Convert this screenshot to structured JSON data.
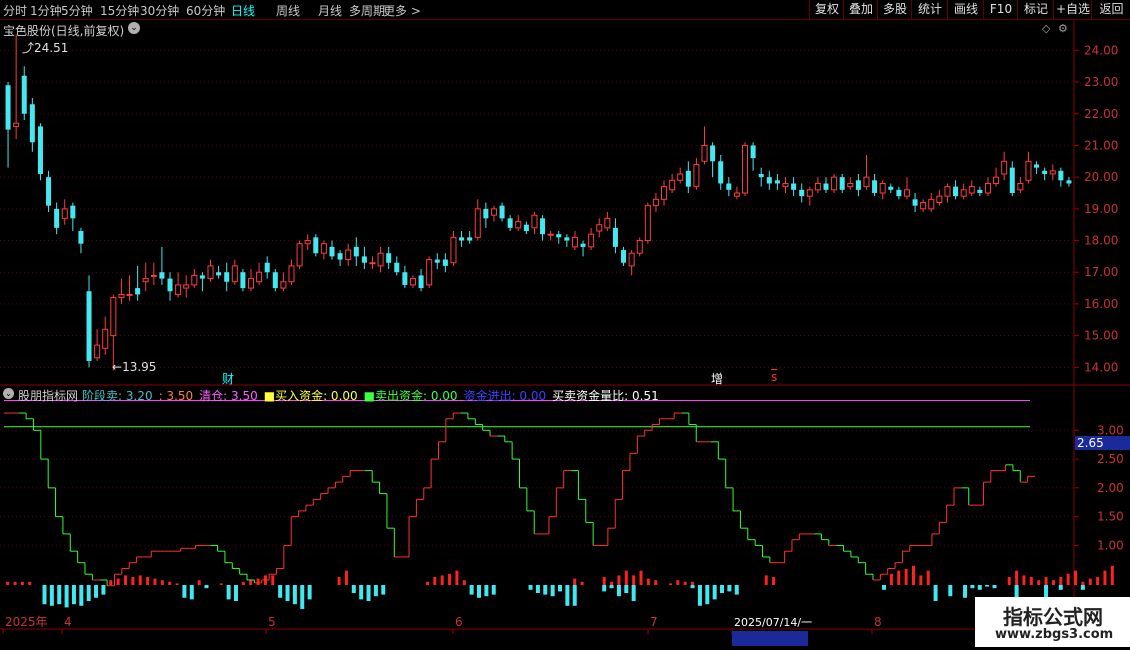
{
  "toolbar": {
    "periods": [
      "分时",
      "1分钟",
      "5分钟",
      "15分钟",
      "30分钟",
      "60分钟",
      "日线",
      "周线",
      "月线",
      "多周期",
      "更多 >"
    ],
    "active_period": "日线",
    "right_buttons": [
      "复权",
      "叠加",
      "多股",
      "统计",
      "画线",
      "F10",
      "标记",
      "+自选",
      "返回"
    ]
  },
  "main_chart": {
    "title": "宝色股份(日线,前复权)",
    "high_label": "24.51",
    "low_label": "13.95",
    "event_markers": [
      {
        "text": "财",
        "color": "#00ffff"
      },
      {
        "text": "增",
        "color": "#ffffff"
      },
      {
        "text": "s",
        "color": "#ff3030"
      }
    ],
    "y_ticks": [
      "24.00",
      "23.00",
      "22.00",
      "21.00",
      "20.00",
      "19.00",
      "18.00",
      "17.00",
      "16.00",
      "15.00",
      "14.00"
    ]
  },
  "indicator_panel": {
    "name": "股朋指标网",
    "items": [
      {
        "label": "阶段卖:",
        "value": "3.20",
        "color": "#40c0c0"
      },
      {
        "label": ":",
        "value": "3.50",
        "color": "#ff8040"
      },
      {
        "label": "清仓:",
        "value": "3.50",
        "color": "#ff60ff"
      },
      {
        "label": "■买入资金:",
        "value": "0.00",
        "color": "#ffff40"
      },
      {
        "label": "■卖出资金:",
        "value": "0.00",
        "color": "#40ff40"
      },
      {
        "label": "资金进出:",
        "value": "0.00",
        "color": "#4040ff"
      },
      {
        "label": "买卖资金量比:",
        "value": "0.51",
        "color": "#ffffff"
      }
    ],
    "y_ticks": [
      "3.00",
      "2.50",
      "2.00",
      "1.50",
      "1.00"
    ],
    "current_value": "2.65"
  },
  "time_axis": {
    "labels": [
      "2025年",
      "4",
      "5",
      "6",
      "7",
      "2025/07/14/一",
      "8"
    ]
  },
  "watermark": {
    "title": "指标公式网",
    "url": "www.zbgs3.com"
  },
  "chart_data": [
    {
      "type": "candlestick",
      "title": "宝色股份(日线,前复权)",
      "ylim": [
        13.6,
        24.8
      ],
      "high": 24.51,
      "low": 13.95,
      "candles": [
        [
          22.9,
          21.5,
          23.0,
          20.3
        ],
        [
          21.6,
          21.7,
          24.5,
          21.2
        ],
        [
          23.2,
          22.0,
          23.5,
          21.8
        ],
        [
          22.3,
          21.1,
          22.5,
          20.8
        ],
        [
          21.6,
          20.1,
          21.7,
          19.9
        ],
        [
          20.0,
          19.1,
          20.2,
          18.9
        ],
        [
          19.0,
          18.4,
          19.2,
          18.2
        ],
        [
          18.7,
          19.0,
          19.3,
          18.5
        ],
        [
          19.1,
          18.7,
          19.2,
          18.3
        ],
        [
          18.3,
          17.9,
          18.4,
          17.6
        ],
        [
          16.4,
          14.2,
          16.9,
          14.0
        ],
        [
          14.3,
          14.7,
          15.2,
          14.2
        ],
        [
          14.6,
          15.2,
          15.6,
          14.4
        ],
        [
          15.0,
          16.2,
          16.3,
          13.9
        ],
        [
          16.2,
          16.3,
          16.8,
          16.0
        ],
        [
          16.3,
          16.3,
          16.9,
          16.1
        ],
        [
          16.5,
          16.3,
          17.2,
          16.1
        ],
        [
          16.7,
          16.8,
          17.3,
          16.4
        ],
        [
          16.9,
          16.9,
          17.3,
          16.6
        ],
        [
          17.0,
          16.8,
          17.8,
          16.6
        ],
        [
          16.8,
          16.4,
          17.0,
          16.1
        ],
        [
          16.3,
          16.6,
          17.0,
          16.2
        ],
        [
          16.5,
          16.6,
          16.9,
          16.2
        ],
        [
          16.6,
          16.9,
          17.1,
          16.5
        ],
        [
          16.9,
          16.8,
          17.0,
          16.4
        ],
        [
          16.8,
          17.2,
          17.4,
          16.7
        ],
        [
          17.0,
          16.9,
          17.2,
          16.8
        ],
        [
          17.0,
          16.7,
          17.3,
          16.4
        ],
        [
          16.7,
          17.2,
          17.4,
          16.6
        ],
        [
          17.0,
          16.5,
          17.1,
          16.4
        ],
        [
          16.5,
          16.8,
          17.1,
          16.4
        ],
        [
          16.7,
          17.0,
          17.3,
          16.6
        ],
        [
          17.3,
          17.0,
          17.5,
          16.8
        ],
        [
          17.0,
          16.5,
          17.1,
          16.4
        ],
        [
          16.5,
          16.7,
          17.0,
          16.4
        ],
        [
          16.7,
          17.2,
          17.4,
          16.6
        ],
        [
          17.2,
          17.9,
          18.0,
          17.1
        ],
        [
          17.9,
          18.0,
          18.2,
          17.7
        ],
        [
          18.1,
          17.6,
          18.2,
          17.5
        ],
        [
          17.6,
          17.9,
          18.0,
          17.4
        ],
        [
          17.8,
          17.5,
          18.0,
          17.4
        ],
        [
          17.6,
          17.4,
          17.7,
          17.2
        ],
        [
          17.4,
          17.7,
          17.9,
          17.2
        ],
        [
          17.8,
          17.5,
          18.1,
          17.2
        ],
        [
          17.5,
          17.3,
          17.8,
          17.1
        ],
        [
          17.3,
          17.3,
          17.5,
          17.1
        ],
        [
          17.2,
          17.6,
          17.8,
          17.0
        ],
        [
          17.6,
          17.3,
          17.8,
          17.1
        ],
        [
          17.3,
          17.0,
          17.5,
          16.9
        ],
        [
          17.0,
          16.6,
          17.2,
          16.5
        ],
        [
          16.6,
          16.8,
          16.9,
          16.5
        ],
        [
          16.9,
          16.5,
          17.1,
          16.4
        ],
        [
          16.6,
          17.4,
          17.5,
          16.5
        ],
        [
          17.4,
          17.3,
          17.6,
          17.1
        ],
        [
          17.4,
          17.2,
          17.6,
          17.0
        ],
        [
          17.3,
          18.1,
          18.3,
          17.2
        ],
        [
          18.1,
          18.0,
          18.3,
          17.8
        ],
        [
          18.1,
          18.0,
          18.3,
          17.9
        ],
        [
          18.1,
          19.0,
          19.3,
          18.0
        ],
        [
          19.0,
          18.7,
          19.2,
          18.4
        ],
        [
          18.8,
          19.0,
          19.1,
          18.6
        ],
        [
          19.1,
          18.7,
          19.2,
          18.6
        ],
        [
          18.7,
          18.4,
          18.8,
          18.3
        ],
        [
          18.4,
          18.6,
          18.8,
          18.3
        ],
        [
          18.5,
          18.3,
          18.6,
          18.2
        ],
        [
          18.4,
          18.8,
          18.9,
          18.2
        ],
        [
          18.7,
          18.2,
          18.8,
          18.0
        ],
        [
          18.2,
          18.2,
          18.3,
          18.0
        ],
        [
          18.2,
          18.1,
          18.3,
          17.9
        ],
        [
          18.1,
          18.0,
          18.2,
          17.8
        ],
        [
          17.8,
          18.1,
          18.3,
          17.7
        ],
        [
          17.9,
          17.8,
          18.0,
          17.5
        ],
        [
          17.8,
          18.2,
          18.4,
          17.7
        ],
        [
          18.3,
          18.5,
          18.7,
          18.1
        ],
        [
          18.4,
          18.7,
          18.9,
          18.3
        ],
        [
          18.4,
          17.8,
          18.7,
          17.6
        ],
        [
          17.7,
          17.3,
          17.8,
          17.2
        ],
        [
          17.2,
          17.6,
          17.7,
          16.9
        ],
        [
          17.6,
          18.0,
          18.1,
          17.5
        ],
        [
          18.0,
          19.1,
          19.2,
          17.9
        ],
        [
          19.1,
          19.3,
          19.5,
          18.9
        ],
        [
          19.3,
          19.7,
          19.9,
          19.1
        ],
        [
          19.6,
          19.9,
          20.1,
          19.5
        ],
        [
          19.9,
          20.1,
          20.3,
          19.8
        ],
        [
          20.2,
          19.7,
          20.5,
          19.5
        ],
        [
          19.7,
          20.4,
          20.6,
          19.6
        ],
        [
          20.5,
          21.0,
          21.6,
          20.4
        ],
        [
          21.0,
          20.5,
          21.1,
          20.0
        ],
        [
          20.5,
          19.8,
          20.7,
          19.6
        ],
        [
          19.8,
          19.6,
          20.0,
          19.4
        ],
        [
          19.4,
          19.5,
          19.7,
          19.3
        ],
        [
          19.5,
          21.0,
          21.1,
          19.4
        ],
        [
          21.0,
          20.6,
          21.1,
          20.2
        ],
        [
          20.1,
          20.0,
          20.3,
          19.7
        ],
        [
          20.0,
          19.8,
          20.2,
          19.6
        ],
        [
          19.9,
          19.8,
          20.1,
          19.6
        ],
        [
          19.7,
          19.8,
          20.0,
          19.5
        ],
        [
          19.8,
          19.6,
          20.0,
          19.4
        ],
        [
          19.6,
          19.4,
          19.8,
          19.2
        ],
        [
          19.4,
          19.6,
          19.7,
          19.1
        ],
        [
          19.6,
          19.8,
          20.0,
          19.5
        ],
        [
          19.8,
          19.6,
          20.0,
          19.5
        ],
        [
          19.6,
          20.0,
          20.1,
          19.5
        ],
        [
          20.0,
          19.6,
          20.1,
          19.5
        ],
        [
          19.7,
          19.8,
          20.0,
          19.6
        ],
        [
          19.9,
          19.6,
          20.1,
          19.4
        ],
        [
          19.7,
          20.0,
          20.7,
          19.6
        ],
        [
          19.9,
          19.5,
          20.1,
          19.4
        ],
        [
          19.5,
          19.8,
          19.9,
          19.3
        ],
        [
          19.7,
          19.6,
          19.8,
          19.5
        ],
        [
          19.6,
          19.4,
          19.7,
          19.3
        ],
        [
          19.4,
          19.6,
          20.0,
          19.3
        ],
        [
          19.3,
          19.1,
          19.5,
          18.9
        ],
        [
          19.0,
          19.2,
          19.3,
          18.9
        ],
        [
          19.0,
          19.3,
          19.5,
          18.9
        ],
        [
          19.2,
          19.4,
          19.6,
          19.1
        ],
        [
          19.4,
          19.7,
          19.8,
          19.2
        ],
        [
          19.7,
          19.4,
          19.9,
          19.3
        ],
        [
          19.4,
          19.6,
          19.8,
          19.3
        ],
        [
          19.5,
          19.7,
          19.9,
          19.4
        ],
        [
          19.6,
          19.5,
          19.7,
          19.4
        ],
        [
          19.5,
          19.8,
          20.0,
          19.4
        ],
        [
          19.8,
          20.0,
          20.3,
          19.7
        ],
        [
          20.1,
          20.5,
          20.8,
          19.9
        ],
        [
          20.3,
          19.5,
          20.5,
          19.4
        ],
        [
          19.6,
          19.8,
          20.0,
          19.5
        ],
        [
          19.9,
          20.5,
          20.8,
          19.8
        ],
        [
          20.4,
          20.3,
          20.5,
          20.1
        ],
        [
          20.2,
          20.1,
          20.3,
          19.9
        ],
        [
          20.1,
          20.2,
          20.4,
          19.9
        ],
        [
          20.2,
          19.9,
          20.3,
          19.7
        ],
        [
          19.9,
          19.8,
          20.0,
          19.7
        ]
      ]
    },
    {
      "type": "stepped-line",
      "title": "股朋指标网",
      "ylim": [
        0,
        3.5
      ],
      "red_line": 3.5,
      "green_line": 3.2,
      "values": [
        3.3,
        3.3,
        3.3,
        3.2,
        3.0,
        2.5,
        2.0,
        1.5,
        1.2,
        0.9,
        0.7,
        0.5,
        0.4,
        0.4,
        0.3,
        0.5,
        0.6,
        0.7,
        0.8,
        0.8,
        0.9,
        0.9,
        0.9,
        0.9,
        0.95,
        0.95,
        1.0,
        1.0,
        1.0,
        0.9,
        0.7,
        0.6,
        0.5,
        0.4,
        0.35,
        0.4,
        0.5,
        0.6,
        1.0,
        1.5,
        1.6,
        1.7,
        1.8,
        1.9,
        2.0,
        2.1,
        2.2,
        2.3,
        2.3,
        2.3,
        2.1,
        1.9,
        1.3,
        0.8,
        0.8,
        1.5,
        1.8,
        2.0,
        2.5,
        2.8,
        3.2,
        3.3,
        3.3,
        3.2,
        3.1,
        3.0,
        2.9,
        2.9,
        2.8,
        2.5,
        2.0,
        1.6,
        1.2,
        1.2,
        1.5,
        2.0,
        2.3,
        2.3,
        1.8,
        1.4,
        1.0,
        1.0,
        1.3,
        1.8,
        2.3,
        2.6,
        2.9,
        3.0,
        3.1,
        3.2,
        3.2,
        3.3,
        3.3,
        3.1,
        2.8,
        2.8,
        2.8,
        2.5,
        2.0,
        1.6,
        1.3,
        1.1,
        1.0,
        0.8,
        0.7,
        0.7,
        0.9,
        1.1,
        1.2,
        1.2,
        1.2,
        1.1,
        1.0,
        1.0,
        0.9,
        0.8,
        0.7,
        0.5,
        0.4,
        0.5,
        0.6,
        0.7,
        0.9,
        1.0,
        1.0,
        1.0,
        1.2,
        1.4,
        1.7,
        2.0,
        2.0,
        1.7,
        1.7,
        2.1,
        2.3,
        2.3,
        2.4,
        2.3,
        2.1,
        2.2
      ],
      "red_bars": [
        0.2,
        0.2,
        0.2,
        0.2,
        0,
        0,
        0,
        0,
        0,
        0,
        0,
        0,
        0,
        0,
        0.3,
        0.4,
        0.6,
        0.5,
        0.6,
        0.5,
        0.4,
        0.3,
        0.2,
        0.1,
        0,
        0,
        0.3,
        0,
        0,
        0.1,
        0,
        0,
        0.2,
        0.3,
        0.4,
        0.6,
        0.6,
        0,
        0,
        0,
        0,
        0,
        0,
        0,
        0,
        0.5,
        0.9,
        0,
        0,
        0,
        0,
        0,
        0,
        0,
        0,
        0,
        0,
        0.2,
        0.5,
        0.6,
        0.7,
        0.9,
        0.3,
        0,
        0,
        0,
        0,
        0,
        0,
        0,
        0,
        0,
        0,
        0,
        0,
        0,
        0,
        0.4,
        0.2,
        0,
        0,
        0.5,
        0.2,
        0.6,
        0.9,
        0.6,
        0.9,
        0.4,
        0.3,
        0,
        0.1,
        0.3,
        0.2,
        0.2,
        0,
        0,
        0,
        0,
        0,
        0,
        0,
        0,
        0,
        0.6,
        0.5,
        0,
        0,
        0,
        0,
        0,
        0,
        0,
        0,
        0,
        0,
        0,
        0,
        0,
        0,
        0,
        0.7,
        0.9,
        1.0,
        1.2,
        0.6,
        0.9,
        0,
        0,
        0,
        0,
        0,
        0,
        0,
        0,
        0,
        0,
        0.5,
        0.9,
        0.6,
        0.5,
        0.3,
        0.5,
        0.3,
        0.5,
        0.7,
        0.9,
        0.2,
        0.4,
        0.5,
        0.9,
        1.2
      ],
      "cyan_bars": [
        0,
        0,
        0,
        0,
        0,
        1.2,
        1.3,
        1.2,
        1.4,
        1.2,
        1.3,
        1.0,
        0.8,
        0.6,
        0,
        0,
        0,
        0,
        0,
        0,
        0,
        0,
        0,
        0,
        0.8,
        0.9,
        0,
        0.2,
        0,
        0,
        0.9,
        1.0,
        0,
        0,
        0,
        0,
        0,
        0.8,
        1.0,
        1.2,
        1.5,
        0.9,
        0,
        0,
        0,
        0,
        0,
        0.5,
        0.9,
        1.0,
        0.7,
        0.6,
        0,
        0,
        0,
        0,
        0,
        0,
        0,
        0,
        0,
        0,
        0,
        0.6,
        0.8,
        0.7,
        0.6,
        0,
        0,
        0,
        0,
        0.3,
        0.5,
        0.6,
        0.7,
        0.4,
        1.3,
        1.3,
        0,
        0,
        0,
        0.4,
        0.2,
        0.7,
        0.5,
        1.0,
        0,
        0,
        0,
        0,
        0,
        0,
        0,
        0.2,
        1.3,
        1.2,
        0.9,
        0.5,
        0.4,
        0.6,
        0,
        0,
        0,
        0,
        0,
        0,
        0,
        0,
        0,
        0,
        0,
        0,
        0,
        0,
        0,
        0,
        0,
        0,
        0,
        0.3,
        0,
        0,
        0,
        0,
        0,
        0,
        1.0,
        0,
        0.7,
        0,
        0.8,
        0.2,
        0.3,
        0.1,
        0.2,
        0,
        0,
        1.0,
        0,
        0,
        0,
        0.9,
        0,
        0.3,
        0,
        0,
        0.3
      ]
    }
  ]
}
